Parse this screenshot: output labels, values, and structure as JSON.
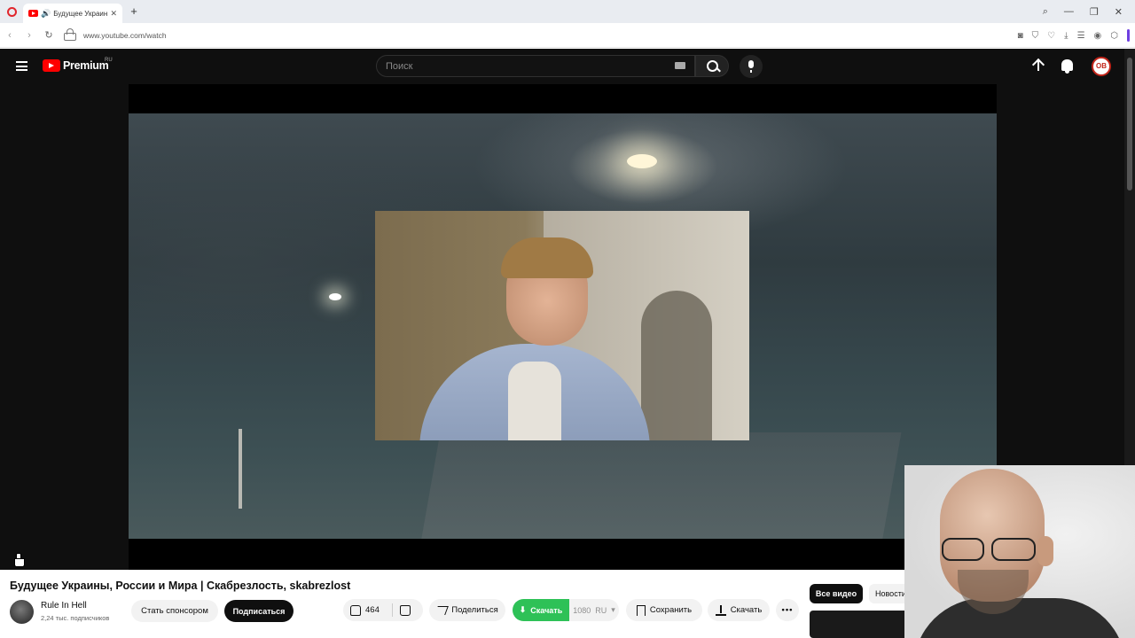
{
  "browser": {
    "tab_title": "Будущее Украины, Р",
    "url": "www.youtube.com/watch",
    "accent": "#6e3fe0"
  },
  "header": {
    "logo_text": "Premium",
    "logo_region": "RU",
    "search_placeholder": "Поиск",
    "avatar_initials": "ОВ"
  },
  "video": {
    "title": "Будущее Украины, России и Мира | Скабрезлость, skabrezlost",
    "channel_name": "Rule In Hell",
    "subscribers": "2,24 тыс. подписчиков",
    "sponsor_label": "Стать спонсором",
    "subscribe_label": "Подписаться",
    "like_count": "464",
    "share_label": "Поделиться",
    "download_green_label": "Скачать",
    "download_resolution": "1080",
    "download_region": "RU",
    "save_label": "Сохранить",
    "download_label": "Скачать",
    "more_label": "•••"
  },
  "recommendations": {
    "chip_all": "Все видео",
    "chip_news": "Новости поли"
  },
  "colors": {
    "brand_red": "#ff0000",
    "download_green": "#2ec157",
    "dark_bg": "#0f0f0f"
  }
}
